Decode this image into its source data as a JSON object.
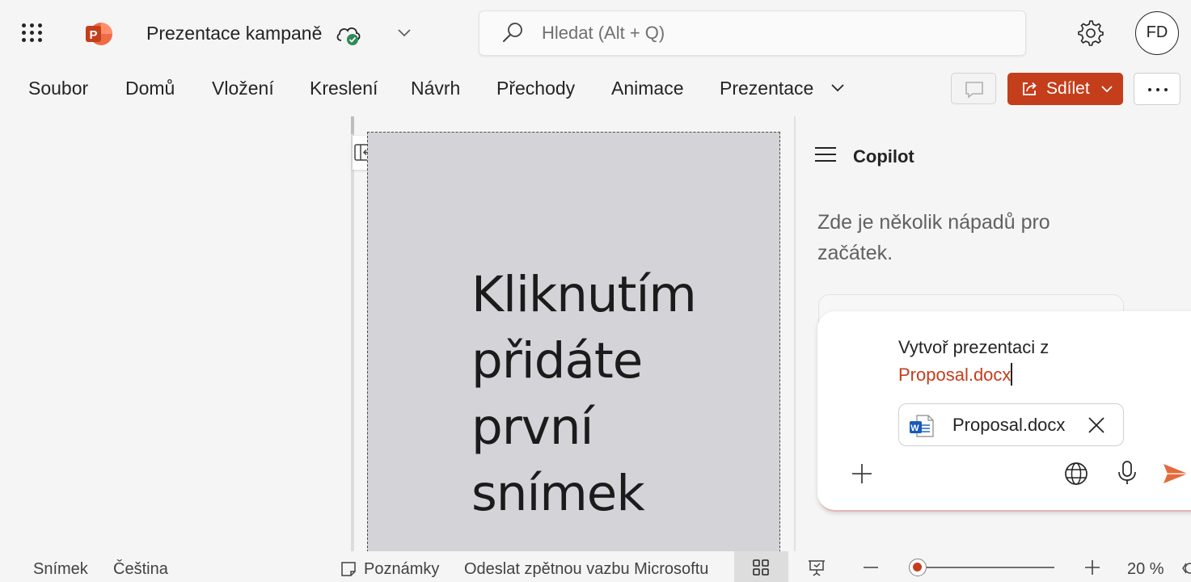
{
  "app": {
    "document_title": "Prezentace kampaně",
    "brand_color": "#c43e1c",
    "icons": [
      "app-launcher-icon",
      "powerpoint-logo-icon",
      "cloud-saved-icon",
      "chevron-down-icon",
      "search-icon",
      "gear-icon"
    ]
  },
  "search": {
    "placeholder": "Hledat (Alt + Q)"
  },
  "account": {
    "initials": "FD"
  },
  "ribbon": {
    "tabs": [
      {
        "label": "Soubor"
      },
      {
        "label": "Domů"
      },
      {
        "label": "Vložení"
      },
      {
        "label": "Kreslení"
      },
      {
        "label": "Návrh"
      },
      {
        "label": "Přechody"
      },
      {
        "label": "Animace"
      },
      {
        "label": "Prezentace"
      }
    ],
    "share_label": "Sdílet"
  },
  "slide": {
    "placeholder_text": "Kliknutím přidáte první snímek"
  },
  "copilot": {
    "title": "Copilot",
    "hint": "Zde je několik nápadů pro začátek.",
    "prompt_text": "Vytvoř prezentaci z ",
    "prompt_file_ref": "Proposal.docx",
    "attached_file": "Proposal.docx"
  },
  "status": {
    "slide_label": "Snímek",
    "language": "Čeština",
    "notes_label": "Poznámky",
    "feedback_label": "Odeslat zpětnou vazbu Microsoftu",
    "zoom": "20 %",
    "zoom_level_percent": 20
  }
}
